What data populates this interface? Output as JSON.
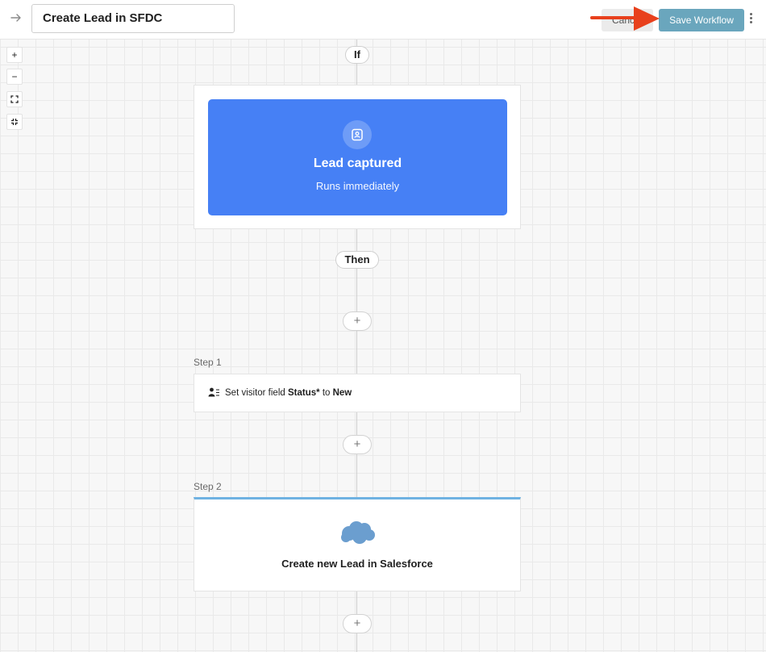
{
  "header": {
    "workflow_name": "Create Lead in SFDC",
    "cancel_label": "Cancel",
    "save_label": "Save Workflow"
  },
  "zoom_controls": {
    "zoom_in": "+",
    "zoom_out": "−"
  },
  "flow": {
    "if_label": "If",
    "then_label": "Then",
    "add_label": "+",
    "trigger": {
      "title": "Lead captured",
      "subtitle": "Runs immediately"
    },
    "steps": [
      {
        "label": "Step 1",
        "prefix": "Set visitor field",
        "field": "Status*",
        "connector": "to",
        "value": "New"
      },
      {
        "label": "Step 2",
        "title": "Create new Lead in Salesforce"
      }
    ]
  },
  "colors": {
    "trigger_blue": "#4680f5",
    "save_button": "#6aa6bd",
    "annotation_arrow": "#e8401c",
    "salesforce_cloud": "#6b9ecf"
  }
}
